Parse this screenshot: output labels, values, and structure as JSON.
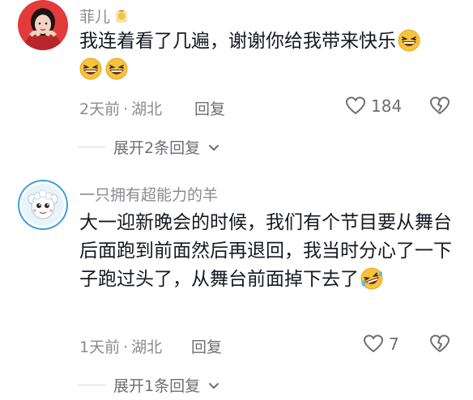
{
  "comments": [
    {
      "username": "菲儿",
      "text": "我连着看了几遍，谢谢你给我带来快乐",
      "time": "2天前",
      "location": "湖北",
      "reply_label": "回复",
      "likes": "184",
      "expand_label": "展开2条回复"
    },
    {
      "username": "一只拥有超能力的羊",
      "text": "大一迎新晚会的时候，我们有个节目要从舞台后面跑到前面然后再退回，我当时分心了一下子跑过头了，从舞台前面掉下去了",
      "time": "1天前",
      "location": "湖北",
      "reply_label": "回复",
      "likes": "7",
      "expand_label": "展开1条回复"
    }
  ],
  "separator": "·",
  "colors": {
    "secondary_text": "#8a8b91",
    "primary_text": "#161823",
    "divider": "#d8d9dc",
    "emoji_face": "#f7c33b"
  },
  "icons": {
    "like": "heart-outline-icon",
    "dislike": "broken-heart-icon",
    "expand": "chevron-down-icon",
    "emoji_1": "laughing-emoji",
    "emoji_2": "rolling-laughing-emoji"
  }
}
